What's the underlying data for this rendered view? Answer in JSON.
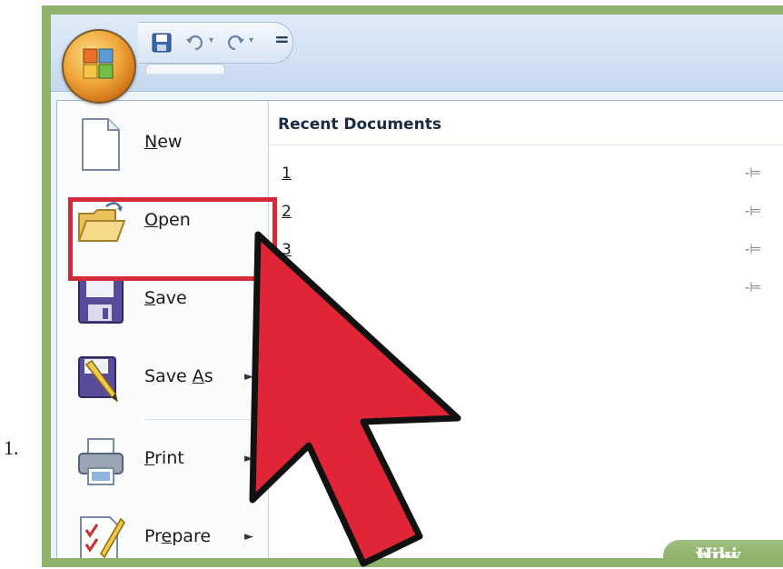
{
  "step_number": "1.",
  "quick_access_toolbar": {
    "icons": [
      "save-icon",
      "undo-icon",
      "redo-icon",
      "customize-icon"
    ],
    "customize_glyph": "="
  },
  "menu": {
    "items": [
      {
        "label": "New",
        "mnemonic": "N",
        "rest": "ew",
        "has_submenu": false,
        "icon": "new-document-icon"
      },
      {
        "label": "Open",
        "mnemonic": "O",
        "rest": "pen",
        "has_submenu": false,
        "icon": "open-folder-icon"
      },
      {
        "label": "Save",
        "mnemonic": "S",
        "rest": "ave",
        "has_submenu": false,
        "icon": "save-disk-icon"
      },
      {
        "label": "Save As",
        "prefix": "Save ",
        "mnemonic": "A",
        "rest": "s",
        "has_submenu": true,
        "icon": "save-as-icon"
      },
      {
        "label": "Print",
        "mnemonic": "P",
        "rest": "rint",
        "has_submenu": true,
        "icon": "printer-icon"
      },
      {
        "label": "Prepare",
        "prefix": "Pr",
        "mnemonic": "e",
        "rest": "pare",
        "has_submenu": true,
        "icon": "prepare-icon"
      }
    ],
    "submenu_arrow": "►"
  },
  "recent": {
    "title": "Recent Documents",
    "items": [
      "1",
      "2",
      "3",
      ""
    ],
    "pin_glyph": "-⊨"
  },
  "colors": {
    "highlight": "#d52a3a",
    "cursor_fill": "#e02636",
    "frame_green": "#8fb26a"
  },
  "watermark": {
    "part1": "wiki",
    "part2": "How"
  }
}
